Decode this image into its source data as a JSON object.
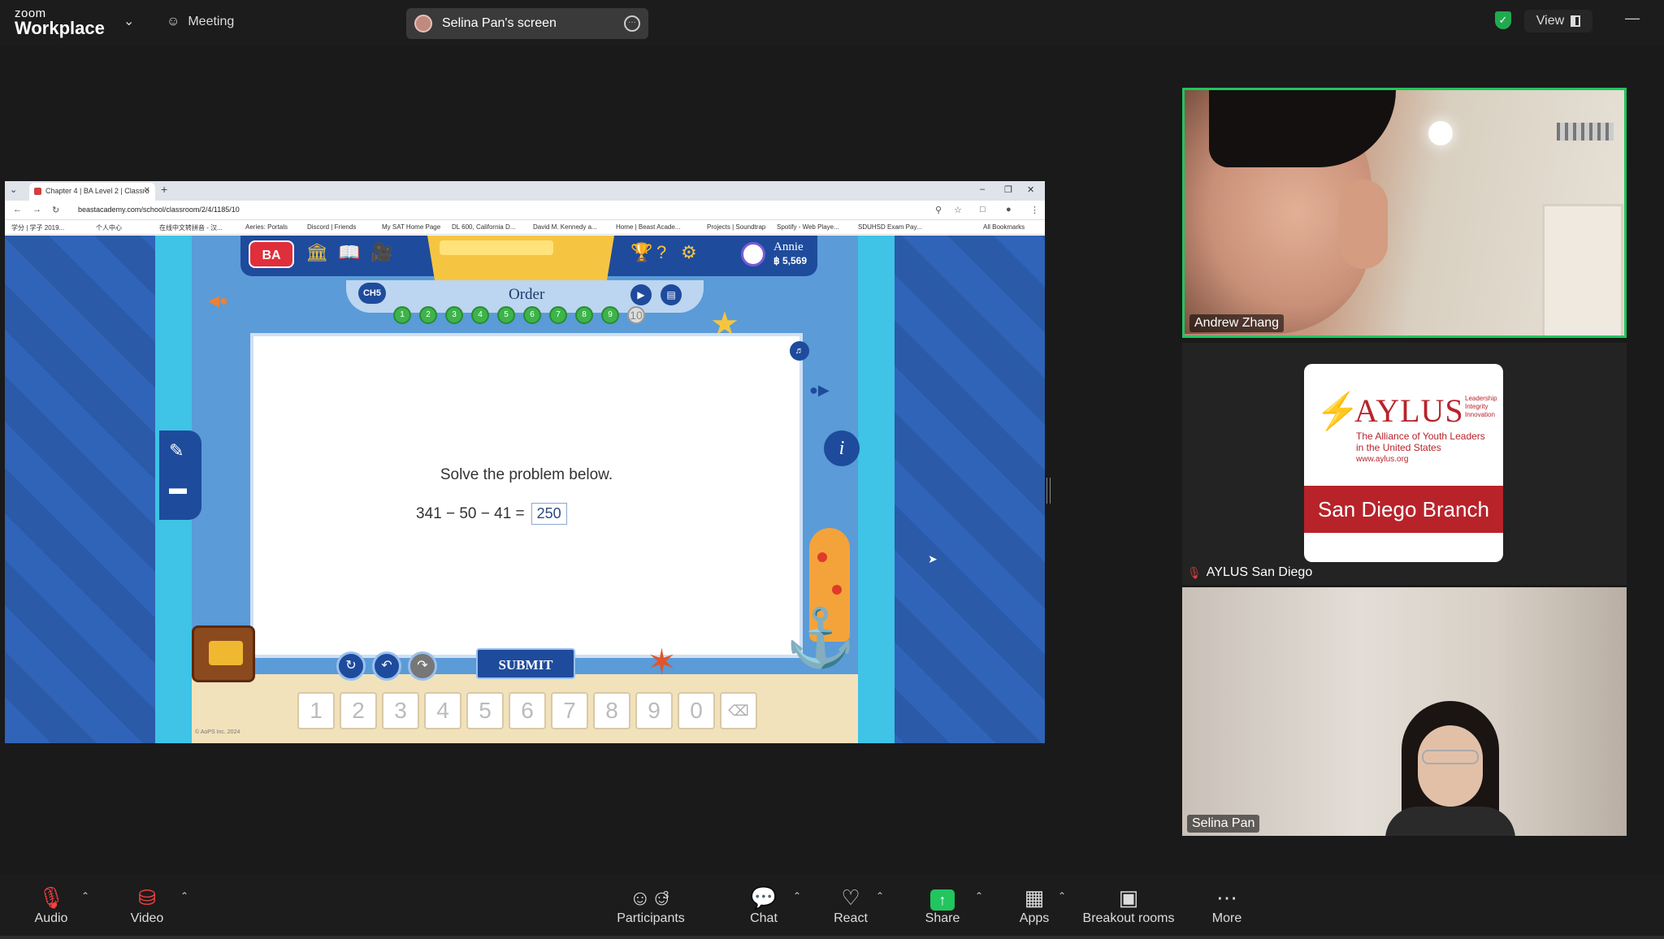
{
  "topbar": {
    "brand_small": "zoom",
    "brand_big": "Workplace",
    "meeting_label": "Meeting",
    "screen_share_label": "Selina Pan's screen",
    "view_label": "View"
  },
  "browser": {
    "tab_title": "Chapter 4 | BA Level 2 | Classro",
    "url": "beastacademy.com/school/classroom/2/4/1185/10",
    "bookmarks": [
      "学分 | 学子 2019...",
      "个人中心",
      "在线中文转拼音 - 汉...",
      "Aeries: Portals",
      "Discord | Friends",
      "My SAT Home Page",
      "DL 600, California D...",
      "David M. Kennedy a...",
      "Home | Beast Acade...",
      "Projects | Soundtrap",
      "Spotify - Web Playe...",
      "SDUHSD Exam Pay..."
    ],
    "all_bookmarks": "All Bookmarks"
  },
  "game": {
    "logo": "BA",
    "user_name": "Annie",
    "user_coins": "฿ 5,569",
    "chapter_btn": "CH5",
    "section_title": "Order",
    "progress": [
      "1",
      "2",
      "3",
      "4",
      "5",
      "6",
      "7",
      "8",
      "9",
      "10"
    ],
    "current_problem": 10,
    "heading": "Solve the problem below.",
    "expression": "341 − 50 − 41 =",
    "answer": "250",
    "submit": "SUBMIT",
    "keys": [
      "1",
      "2",
      "3",
      "4",
      "5",
      "6",
      "7",
      "8",
      "9",
      "0"
    ],
    "copyright": "© AoPS Inc. 2024"
  },
  "participants": {
    "tile1_name": "Andrew Zhang",
    "tile2_name": "AYLUS San Diego",
    "tile3_name": "Selina Pan",
    "aylus": {
      "title": "AYLUS",
      "tagline_1": "Leadership",
      "tagline_2": "Integrity",
      "tagline_3": "Innovation",
      "sub_1": "The Alliance of Youth Leaders",
      "sub_2": "in the United States",
      "url": "www.aylus.org",
      "branch": "San Diego Branch"
    }
  },
  "toolbar": {
    "audio": "Audio",
    "video": "Video",
    "participants": "Participants",
    "participant_count": "3",
    "chat": "Chat",
    "react": "React",
    "share": "Share",
    "apps": "Apps",
    "breakout": "Breakout rooms",
    "more": "More"
  },
  "colors": {
    "active_speaker_border": "#22c55e",
    "share_green": "#22c55e",
    "muted_red": "#ff4040",
    "aylus_red": "#b8232a",
    "game_blue": "#1e4b9c"
  }
}
